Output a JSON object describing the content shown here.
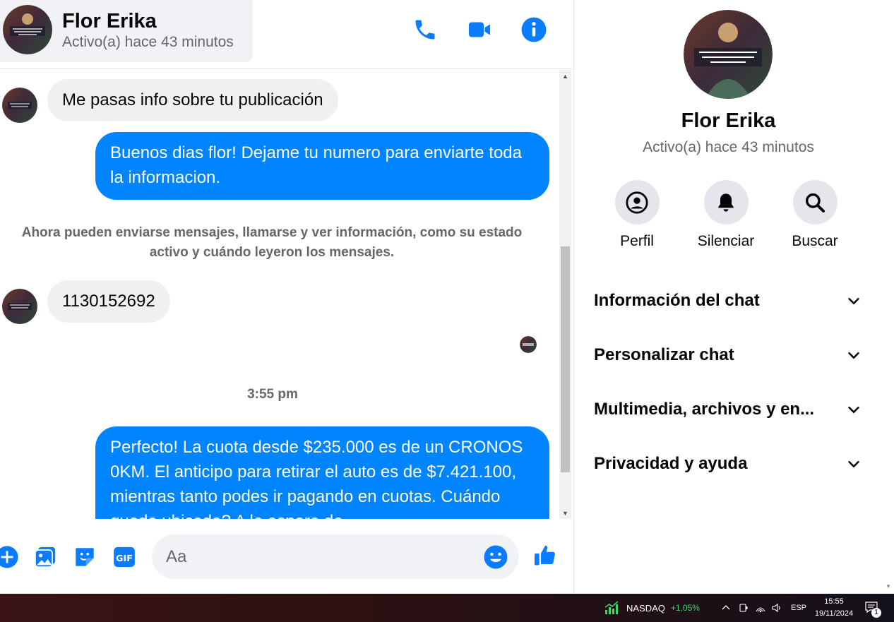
{
  "contact": {
    "name": "Flor Erika",
    "status": "Activo(a) hace 43 minutos"
  },
  "messages": {
    "msg1": "Me pasas info sobre tu publicación",
    "msg2": "Buenos dias flor! Dejame tu numero para enviarte toda la informacion.",
    "system": "Ahora pueden enviarse mensajes, llamarse y ver información, como su estado activo y cuándo leyeron los mensajes.",
    "msg3": "1130152692",
    "timestamp": "3:55 pm",
    "msg4": "Perfecto! La cuota desde $235.000 es de un CRONOS 0KM. El anticipo para retirar el auto es de $7.421.100, mientras tanto podes ir pagando en cuotas. Cuándo queda ubicada? A la espera de"
  },
  "composer": {
    "placeholder": "Aa"
  },
  "panel": {
    "actions": {
      "profile": "Perfil",
      "mute": "Silenciar",
      "search": "Buscar"
    },
    "sections": {
      "chat_info": "Información del chat",
      "customize": "Personalizar chat",
      "media": "Multimedia, archivos y en...",
      "privacy": "Privacidad y ayuda"
    }
  },
  "taskbar": {
    "stock_name": "NASDAQ",
    "stock_change": "+1,05%",
    "language": "ESP",
    "time": "15:55",
    "date": "19/11/2024",
    "notification_count": "1"
  },
  "colors": {
    "accent": "#0084ff",
    "incoming_bubble": "#f0f0f0",
    "icon_blue": "#0a7cff",
    "positive": "#3fd66b"
  },
  "icons": [
    "phone-icon",
    "video-icon",
    "info-icon",
    "plus-icon",
    "image-icon",
    "sticker-icon",
    "gif-icon",
    "emoji-icon",
    "like-icon",
    "profile-icon",
    "bell-icon",
    "search-icon",
    "chevron-down-icon",
    "stock-chart-icon",
    "network-icon",
    "volume-icon",
    "notification-icon"
  ]
}
